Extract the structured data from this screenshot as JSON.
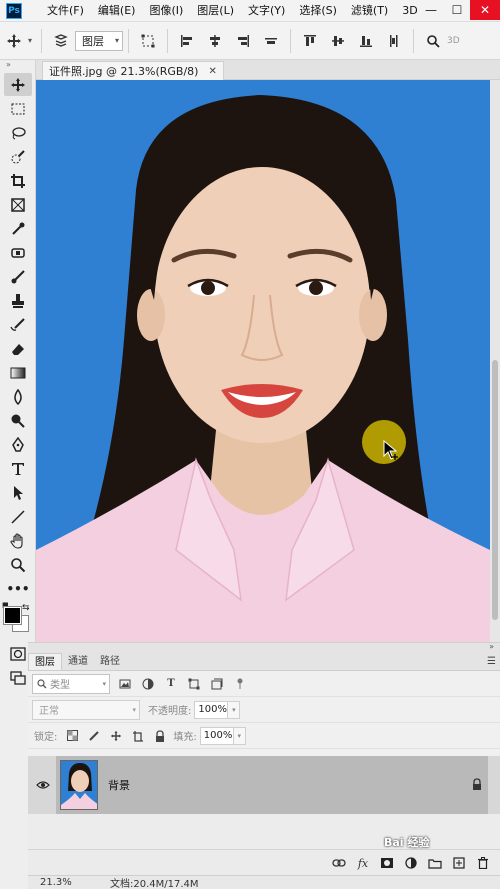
{
  "app": {
    "logo": "Ps"
  },
  "menu": [
    "文件(F)",
    "编辑(E)",
    "图像(I)",
    "图层(L)",
    "文字(Y)",
    "选择(S)",
    "滤镜(T)",
    "3D"
  ],
  "window_controls": {
    "minimize": "—",
    "maximize": "☐",
    "close": "✕"
  },
  "options_bar": {
    "layer_select": "图层",
    "view_3d": "3D"
  },
  "document": {
    "tab_title": "证件照.jpg @ 21.3%(RGB/8)",
    "background_color": "#2f7fd3"
  },
  "layers_panel": {
    "tabs": [
      "图层",
      "通道",
      "路径"
    ],
    "filter_placeholder": "类型",
    "blend_mode": "正常",
    "opacity_label": "不透明度:",
    "opacity_value": "100%",
    "lock_label": "锁定:",
    "fill_label": "填充:",
    "fill_value": "100%",
    "layers": [
      {
        "name": "背景",
        "visible": true,
        "locked": true
      }
    ],
    "footer_icons": [
      "link-icon",
      "fx-icon",
      "mask-icon",
      "adjustment-icon",
      "folder-icon",
      "new-layer-icon",
      "trash-icon"
    ]
  },
  "status": {
    "zoom": "21.3%",
    "doc_size": "文档:20.4M/17.4M"
  },
  "watermark": "Bai 经验",
  "colors": {
    "foreground": "#000000",
    "background": "#ffffff",
    "canvas_bg": "#2f7fd3",
    "cursor_highlight": "#e2c800"
  }
}
